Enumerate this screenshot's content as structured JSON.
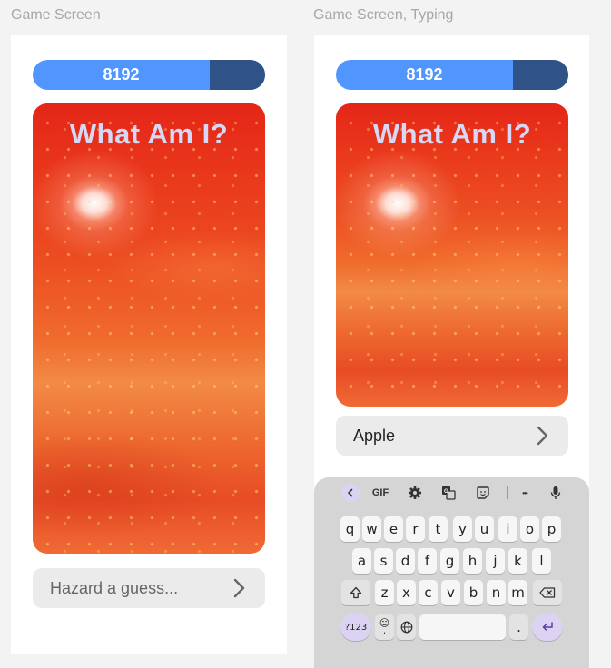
{
  "frames": [
    {
      "label": "Game Screen",
      "score": "8192",
      "title": "What Am I?",
      "guess_placeholder": "Hazard a guess..."
    },
    {
      "label": "Game Screen, Typing",
      "score": "8192",
      "title": "What Am I?",
      "guess_value": "Apple"
    }
  ],
  "keyboard": {
    "toolbar": {
      "gif": "GIF",
      "more": "•••",
      "icons": [
        "chevron-left-icon",
        "gif-icon",
        "gear-icon",
        "translate-icon",
        "sticker-icon",
        "more-icon",
        "mic-icon"
      ]
    },
    "row1": [
      "q",
      "w",
      "e",
      "r",
      "t",
      "y",
      "u",
      "i",
      "o",
      "p"
    ],
    "row2": [
      "a",
      "s",
      "d",
      "f",
      "g",
      "h",
      "j",
      "k",
      "l"
    ],
    "row3": [
      "z",
      "x",
      "c",
      "v",
      "b",
      "n",
      "m"
    ],
    "bottom": {
      "symbols": "?123",
      "emoji": "☺",
      "period": ".",
      "comma": ","
    }
  },
  "colors": {
    "accent": "#5195ff",
    "accent_dark": "#2f5386",
    "title": "#d6d8f5",
    "input_bg": "#ebebeb",
    "keyboard_bg": "#d5d5d5",
    "keyboard_purple": "#dcd3f2"
  }
}
